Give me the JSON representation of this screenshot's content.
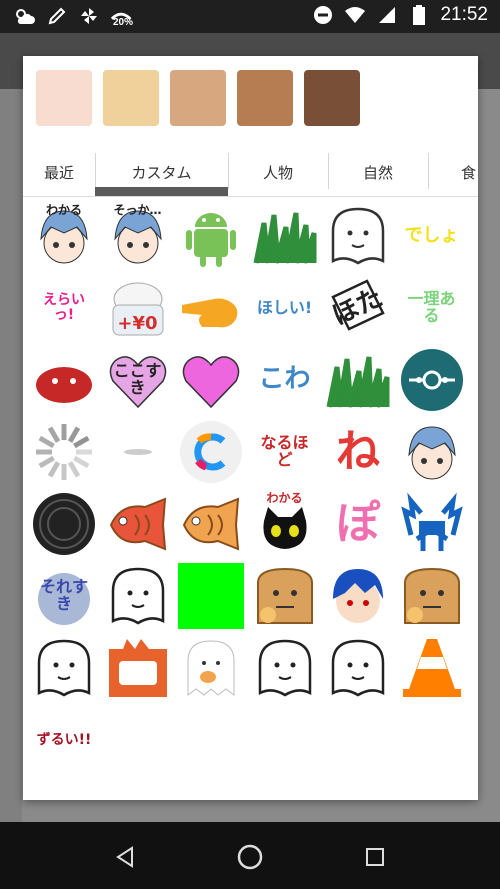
{
  "status_bar": {
    "time": "21:52",
    "battery_saver_label": "20%",
    "icons": [
      "weather-icon",
      "pencil-icon",
      "pinwheel-icon",
      "battery-saver-icon",
      "do-not-disturb-icon",
      "wifi-icon",
      "signal-icon",
      "battery-icon"
    ]
  },
  "skin_tones": [
    "#f9dcd0",
    "#f0d19c",
    "#d7a87f",
    "#b57d51",
    "#7a4f37"
  ],
  "tabs": {
    "recent": "最近",
    "custom": "カスタム",
    "people": "人物",
    "nature": "自然",
    "food": "食"
  },
  "stickers": [
    {
      "name": "sticker-wakaru-girl",
      "text": "わかる",
      "color": "#222222"
    },
    {
      "name": "sticker-pirate-girl",
      "text": "そっか…",
      "color": "#222222"
    },
    {
      "name": "sticker-android",
      "text": "",
      "color": "#78c257"
    },
    {
      "name": "sticker-grass",
      "text": "",
      "color": "#2f8f3a"
    },
    {
      "name": "sticker-moai-face",
      "text": "",
      "color": "#333333"
    },
    {
      "name": "sticker-desho",
      "text": "でしょ",
      "color": "#f2e21b"
    },
    {
      "name": "sticker-erai",
      "text": "えらいっ!",
      "color": "#e91e8c"
    },
    {
      "name": "sticker-rice-yen",
      "text": "+¥0",
      "color": "#d32f2f"
    },
    {
      "name": "sticker-pointing-hand",
      "text": "",
      "color": "#f5a623"
    },
    {
      "name": "sticker-hoshii",
      "text": "ほしい!",
      "color": "#3f87c7"
    },
    {
      "name": "sticker-hota-sign",
      "text": "ほた",
      "color": "#222222"
    },
    {
      "name": "sticker-ichiri-aru",
      "text": "一理ある",
      "color": "#7bd37b"
    },
    {
      "name": "sticker-red-android",
      "text": "",
      "color": "#c62828"
    },
    {
      "name": "sticker-koko-suki",
      "text": "ここすき",
      "color": "#222222"
    },
    {
      "name": "sticker-kore-suki",
      "text": "これすき",
      "color": "#ee66dd"
    },
    {
      "name": "sticker-kowa",
      "text": "こわ",
      "color": "#3f87c7"
    },
    {
      "name": "sticker-grass-2",
      "text": "",
      "color": "#2f8f3a"
    },
    {
      "name": "sticker-teal-circle",
      "text": "",
      "color": "#1e6b73"
    },
    {
      "name": "sticker-loading-spinner",
      "text": "",
      "color": "#888888"
    },
    {
      "name": "sticker-faint-spinner",
      "text": "",
      "color": "#cccccc"
    },
    {
      "name": "sticker-c-logo",
      "text": "",
      "color": "#f0f0f0"
    },
    {
      "name": "sticker-naruhodo",
      "text": "なるほど",
      "color": "#c62828"
    },
    {
      "name": "sticker-ne",
      "text": "ね",
      "color": "#e53935"
    },
    {
      "name": "sticker-crying-girl",
      "text": "",
      "color": "#222222"
    },
    {
      "name": "sticker-oreo",
      "text": "",
      "color": "#222222"
    },
    {
      "name": "sticker-taiyaki-red",
      "text": "",
      "color": "#e8553a"
    },
    {
      "name": "sticker-taiyaki",
      "text": "",
      "color": "#f0a450"
    },
    {
      "name": "sticker-wakaru-cat",
      "text": "わかる",
      "color": "#c62828"
    },
    {
      "name": "sticker-po",
      "text": "ぽ",
      "color": "#f06fb0"
    },
    {
      "name": "sticker-blue-crab",
      "text": "",
      "color": "#1565c0"
    },
    {
      "name": "sticker-sore-suki",
      "text": "それすき",
      "color": "#3949ab"
    },
    {
      "name": "sticker-ghost",
      "text": "",
      "color": "#222222"
    },
    {
      "name": "sticker-green-square",
      "text": "",
      "color": "#00ff00"
    },
    {
      "name": "sticker-bread-thinking",
      "text": "",
      "color": "#d9a15b"
    },
    {
      "name": "sticker-blue-hair-thinking",
      "text": "",
      "color": "#1a4fc0"
    },
    {
      "name": "sticker-bread-thinking-2",
      "text": "",
      "color": "#d9a15b"
    },
    {
      "name": "sticker-blob-face",
      "text": "",
      "color": "#222222"
    },
    {
      "name": "sticker-orange-frame",
      "text": "",
      "color": "#e8622c"
    },
    {
      "name": "sticker-ghost-eating",
      "text": "",
      "color": "#f0a450"
    },
    {
      "name": "sticker-paper-face",
      "text": "",
      "color": "#222222"
    },
    {
      "name": "sticker-smiley-blob",
      "text": "",
      "color": "#222222"
    },
    {
      "name": "sticker-traffic-cone",
      "text": "",
      "color": "#ff7f00"
    },
    {
      "name": "sticker-zurui",
      "text": "ずるい!!",
      "color": "#a31525"
    }
  ]
}
